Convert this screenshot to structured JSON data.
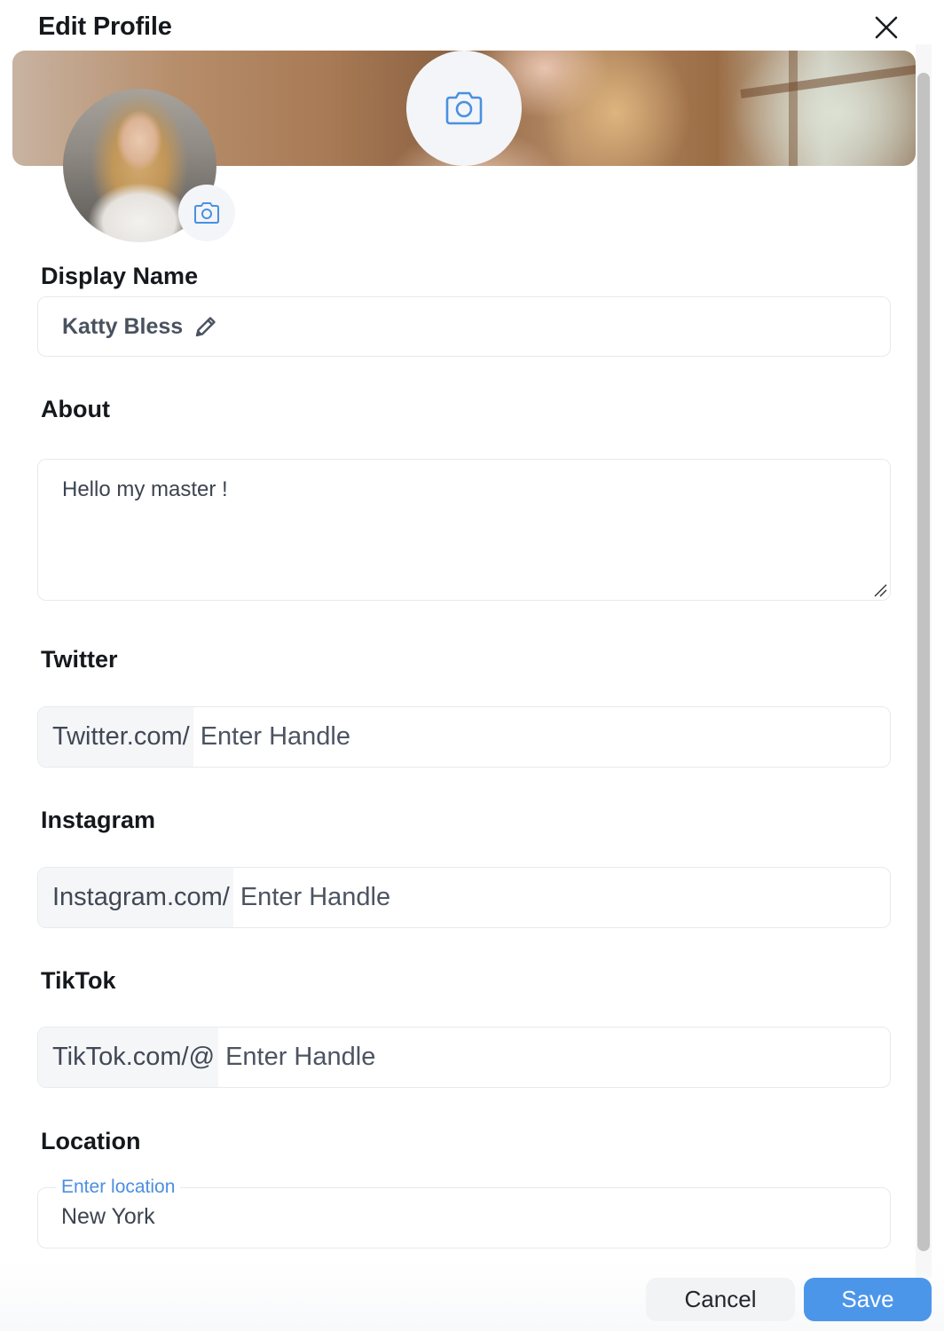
{
  "dialog": {
    "title": "Edit Profile",
    "close_icon": "close-icon"
  },
  "cover": {
    "camera_icon": "camera-icon"
  },
  "avatar": {
    "camera_icon": "camera-icon"
  },
  "display_name": {
    "label": "Display Name",
    "value": "Katty Bless",
    "edit_icon": "pencil-icon"
  },
  "about": {
    "label": "About",
    "value": "Hello my master !"
  },
  "twitter": {
    "label": "Twitter",
    "prefix": "Twitter.com/",
    "placeholder": "Enter Handle"
  },
  "instagram": {
    "label": "Instagram",
    "prefix": "Instagram.com/",
    "placeholder": "Enter Handle"
  },
  "tiktok": {
    "label": "TikTok",
    "prefix": "TikTok.com/@",
    "placeholder": "Enter Handle"
  },
  "location": {
    "label": "Location",
    "field_label": "Enter location",
    "value": "New York"
  },
  "footer": {
    "cancel_label": "Cancel",
    "save_label": "Save"
  },
  "colors": {
    "accent": "#4c96ea",
    "floating_label": "#4a8fe0",
    "icon_blue": "#4a90e2"
  }
}
